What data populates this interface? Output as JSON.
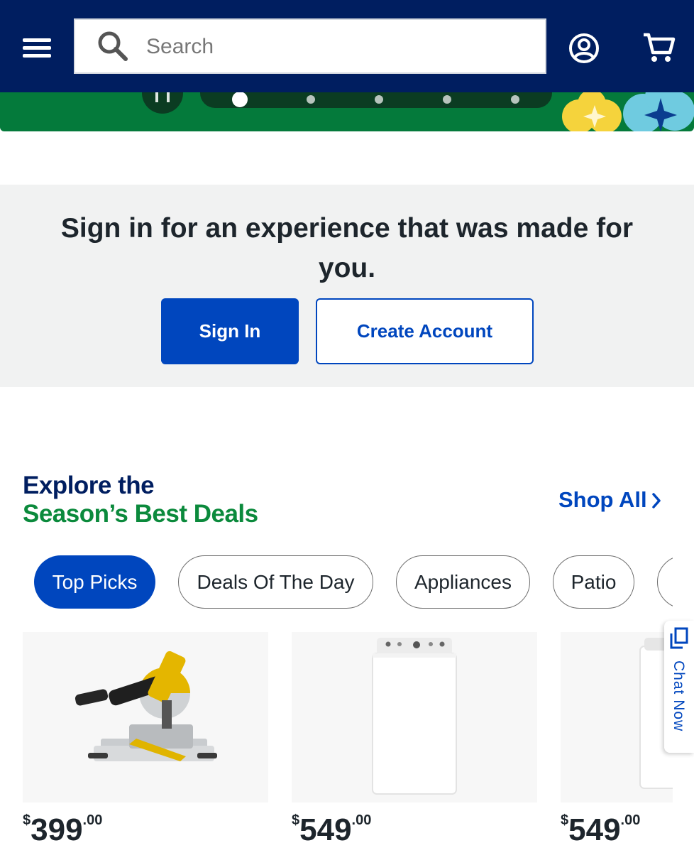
{
  "header": {
    "search_placeholder": "Search"
  },
  "signin_panel": {
    "title": "Sign in for an experience that was made for you.",
    "sign_in_label": "Sign In",
    "create_account_label": "Create Account"
  },
  "deals": {
    "title_line1": "Explore the",
    "title_line2": "Season’s Best Deals",
    "shop_all_label": "Shop All",
    "chips": [
      {
        "label": "Top Picks",
        "active": true
      },
      {
        "label": "Deals Of The Day",
        "active": false
      },
      {
        "label": "Appliances",
        "active": false
      },
      {
        "label": "Patio",
        "active": false
      }
    ],
    "products": [
      {
        "image": "miter-saw",
        "currency": "$",
        "price_whole": "399",
        "price_cents": ".00"
      },
      {
        "image": "washer",
        "currency": "$",
        "price_whole": "549",
        "price_cents": ".00"
      },
      {
        "image": "dryer",
        "currency": "$",
        "price_whole": "549",
        "price_cents": ".00"
      }
    ]
  },
  "chat": {
    "label": "Chat Now"
  },
  "colors": {
    "header_bg": "#001e60",
    "brand_blue": "#0046be",
    "banner_green": "#047a3b",
    "deals_green": "#0b8a3c",
    "panel_bg": "#f1f2f2"
  }
}
